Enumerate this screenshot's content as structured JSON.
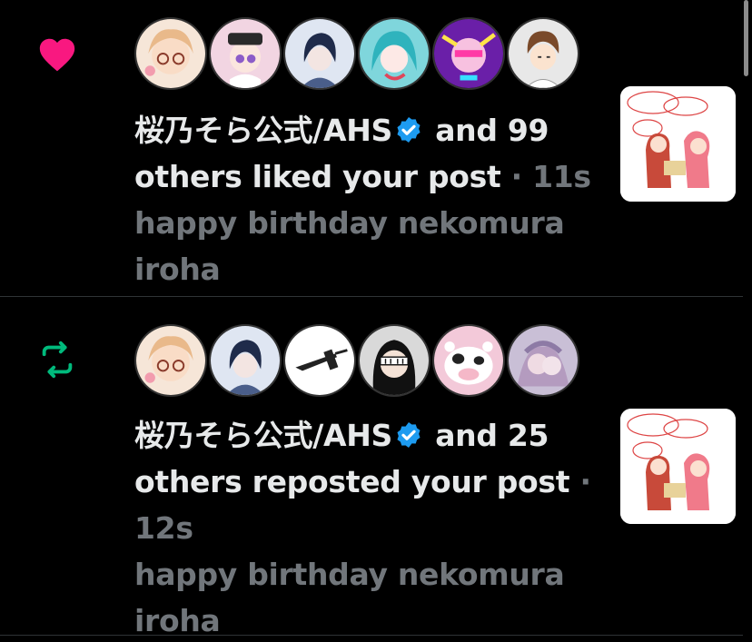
{
  "notifications": [
    {
      "type": "like",
      "icon": "heart-icon",
      "icon_color": "#f91880",
      "actor_name": "桜乃そら公式/AHS",
      "verified": true,
      "summary": "and 99 others liked your post",
      "separator": "·",
      "time": "11s",
      "post_preview": "happy birthday nekomura iroha",
      "avatars": [
        "avatar-1",
        "avatar-2",
        "avatar-3",
        "avatar-4",
        "avatar-5",
        "avatar-6"
      ]
    },
    {
      "type": "repost",
      "icon": "repost-icon",
      "icon_color": "#00ba7c",
      "actor_name": "桜乃そら公式/AHS",
      "verified": true,
      "summary": "and 25 others reposted your post",
      "separator": "·",
      "time": "12s",
      "post_preview": "happy birthday nekomura iroha",
      "avatars": [
        "avatar-1",
        "avatar-2",
        "avatar-3",
        "avatar-4",
        "avatar-5",
        "avatar-6"
      ]
    }
  ],
  "colors": {
    "background": "#000000",
    "text": "#e7e9ea",
    "muted": "#71767b",
    "verified": "#1d9bf0",
    "divider": "#2f3336"
  }
}
